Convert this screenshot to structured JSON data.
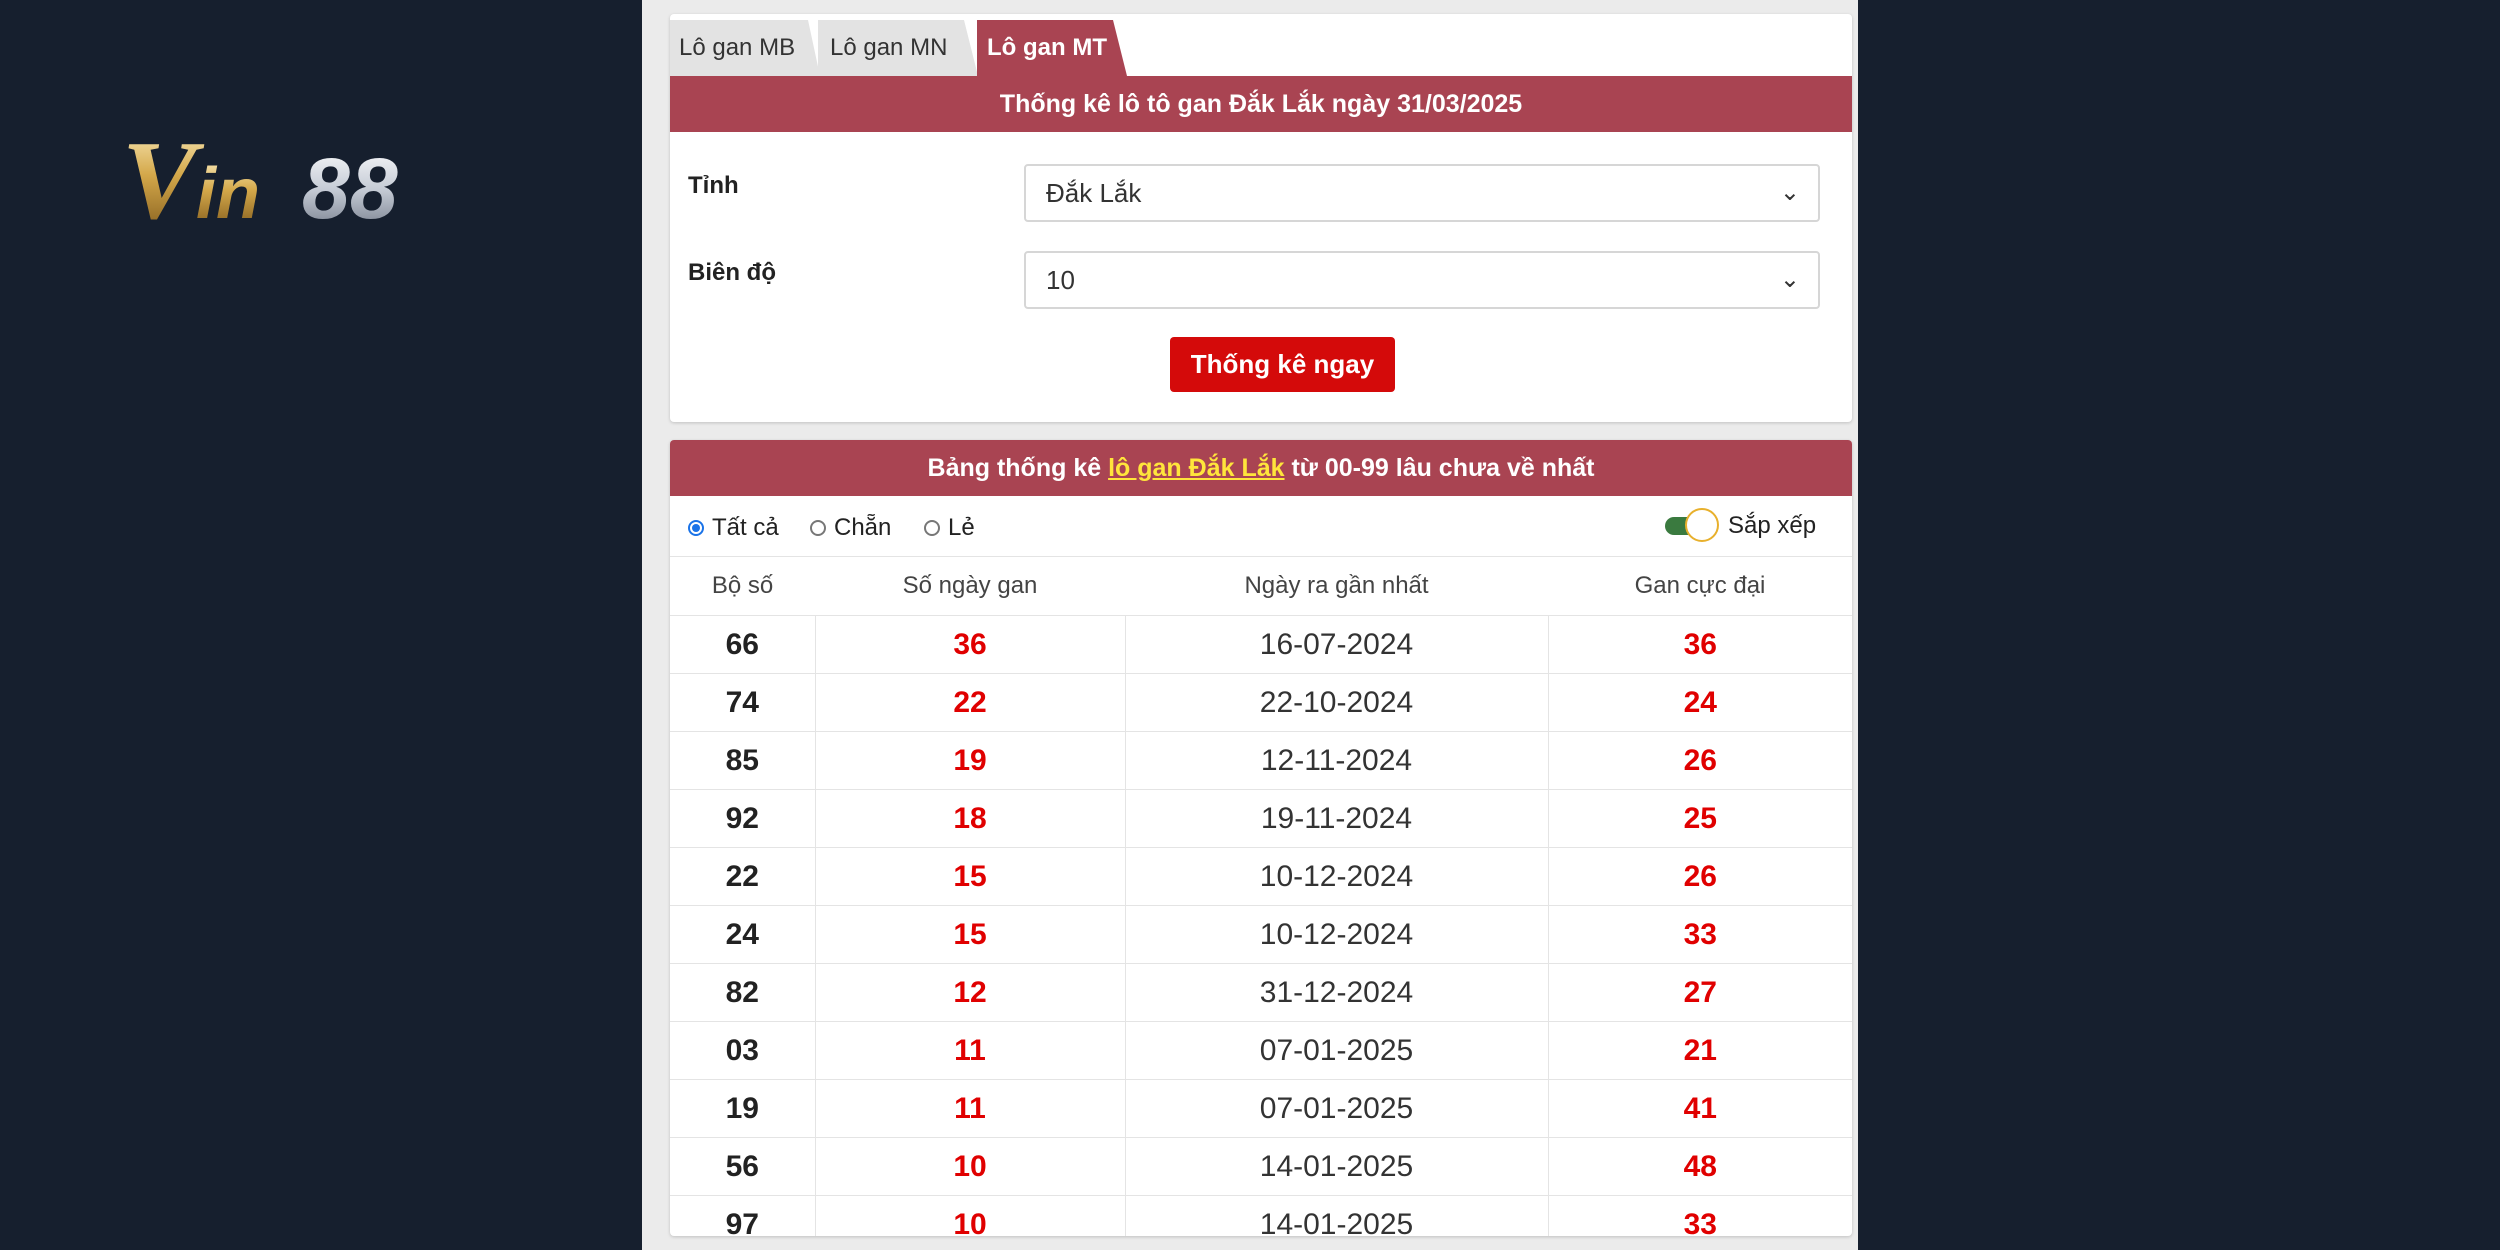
{
  "logo": {
    "text": "Vin88"
  },
  "tabs": [
    {
      "label": "Lô gan MB"
    },
    {
      "label": "Lô gan MN"
    },
    {
      "label": "Lô gan MT"
    }
  ],
  "form": {
    "title": "Thống kê lô tô gan Đắk Lắk ngày 31/03/2025",
    "province_label": "Tỉnh",
    "province_value": "Đắk Lắk",
    "range_label": "Biên độ",
    "range_value": "10",
    "submit_label": "Thống kê ngay"
  },
  "results": {
    "title_prefix": "Bảng thống kê",
    "title_link": "lô gan Đắk Lắk",
    "title_suffix": "từ 00-99 lâu chưa về nhất",
    "filters": {
      "all": "Tất cả",
      "even": "Chẵn",
      "odd": "Lẻ"
    },
    "sort_label": "Sắp xếp",
    "columns": [
      "Bộ số",
      "Số ngày gan",
      "Ngày ra gần nhất",
      "Gan cực đại"
    ],
    "rows": [
      [
        "66",
        "36",
        "16-07-2024",
        "36"
      ],
      [
        "74",
        "22",
        "22-10-2024",
        "24"
      ],
      [
        "85",
        "19",
        "12-11-2024",
        "26"
      ],
      [
        "92",
        "18",
        "19-11-2024",
        "25"
      ],
      [
        "22",
        "15",
        "10-12-2024",
        "26"
      ],
      [
        "24",
        "15",
        "10-12-2024",
        "33"
      ],
      [
        "82",
        "12",
        "31-12-2024",
        "27"
      ],
      [
        "03",
        "11",
        "07-01-2025",
        "21"
      ],
      [
        "19",
        "11",
        "07-01-2025",
        "41"
      ],
      [
        "56",
        "10",
        "14-01-2025",
        "48"
      ],
      [
        "97",
        "10",
        "14-01-2025",
        "33"
      ]
    ]
  },
  "colors": {
    "background": "#161f2e",
    "accent": "#a94452",
    "button": "#d40a0a",
    "value_red": "#e00000",
    "link_yellow": "#ffe53b"
  }
}
